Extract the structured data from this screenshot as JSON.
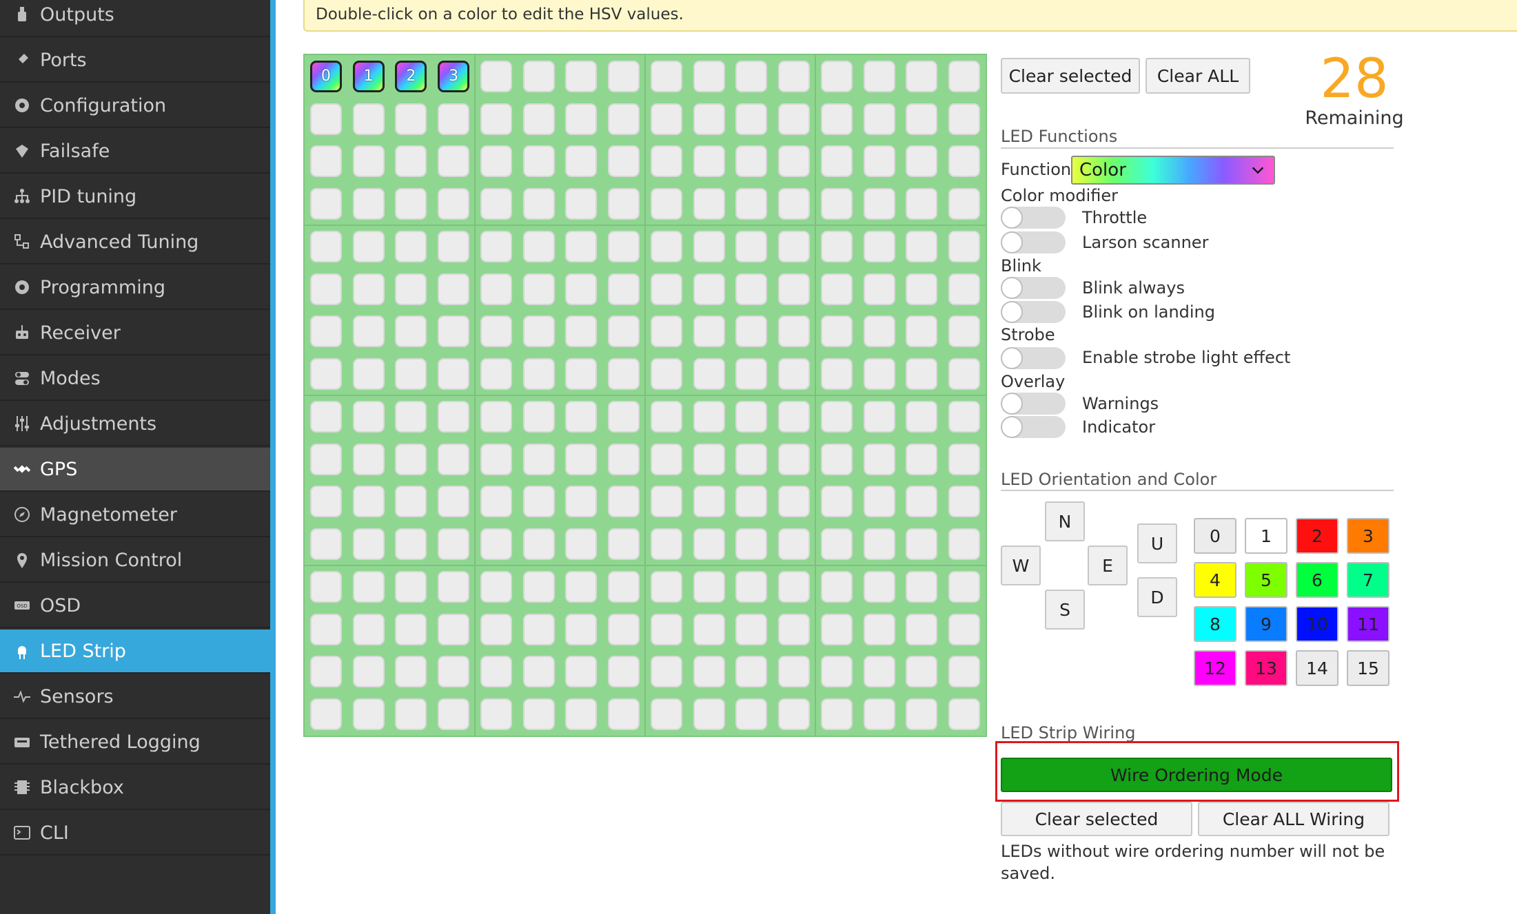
{
  "sidebar": {
    "items": [
      {
        "label": "Outputs",
        "icon": "outputs-icon"
      },
      {
        "label": "Ports",
        "icon": "ports-icon"
      },
      {
        "label": "Configuration",
        "icon": "gear-icon"
      },
      {
        "label": "Failsafe",
        "icon": "failsafe-icon"
      },
      {
        "label": "PID tuning",
        "icon": "pid-icon"
      },
      {
        "label": "Advanced Tuning",
        "icon": "advanced-tuning-icon"
      },
      {
        "label": "Programming",
        "icon": "gear-icon"
      },
      {
        "label": "Receiver",
        "icon": "receiver-icon"
      },
      {
        "label": "Modes",
        "icon": "modes-icon"
      },
      {
        "label": "Adjustments",
        "icon": "adjustments-icon"
      },
      {
        "label": "GPS",
        "icon": "satellite-icon"
      },
      {
        "label": "Magnetometer",
        "icon": "compass-icon"
      },
      {
        "label": "Mission Control",
        "icon": "map-pin-icon"
      },
      {
        "label": "OSD",
        "icon": "osd-icon"
      },
      {
        "label": "LED Strip",
        "icon": "led-icon"
      },
      {
        "label": "Sensors",
        "icon": "pulse-icon"
      },
      {
        "label": "Tethered Logging",
        "icon": "tethered-logging-icon"
      },
      {
        "label": "Blackbox",
        "icon": "blackbox-icon"
      },
      {
        "label": "CLI",
        "icon": "terminal-icon"
      }
    ],
    "active": "LED Strip",
    "accent_color": "#37a8db"
  },
  "note": {
    "text": "Double-click on a color to edit the HSV values."
  },
  "grid": {
    "rows": 16,
    "cols": 16,
    "selected": [
      {
        "label": "0"
      },
      {
        "label": "1"
      },
      {
        "label": "2"
      },
      {
        "label": "3"
      }
    ],
    "background_color": "#8fd790"
  },
  "toolbar": {
    "clear_selected": "Clear selected",
    "clear_all": "Clear ALL"
  },
  "remaining": {
    "count": "28",
    "label": "Remaining",
    "color": "#f9a825"
  },
  "led_functions": {
    "title": "LED Functions",
    "function_label": "Function",
    "function_value": "Color",
    "color_modifier_label": "Color modifier",
    "throttle": "Throttle",
    "larson": "Larson scanner",
    "blink_label": "Blink",
    "blink_always": "Blink always",
    "blink_landing": "Blink on landing",
    "strobe_label": "Strobe",
    "strobe_enable": "Enable strobe light effect",
    "overlay_label": "Overlay",
    "warnings": "Warnings",
    "indicator": "Indicator"
  },
  "orientation": {
    "title": "LED Orientation and Color",
    "n": "N",
    "w": "W",
    "e": "E",
    "s": "S",
    "u": "U",
    "d": "D"
  },
  "colors": [
    {
      "label": "0",
      "bg": "#ececec",
      "fg": "#222222"
    },
    {
      "label": "1",
      "bg": "#ffffff",
      "fg": "#222222"
    },
    {
      "label": "2",
      "bg": "#ff1010",
      "fg": "#222222"
    },
    {
      "label": "3",
      "bg": "#ff7a00",
      "fg": "#222222"
    },
    {
      "label": "4",
      "bg": "#ffff00",
      "fg": "#222222"
    },
    {
      "label": "5",
      "bg": "#7dff00",
      "fg": "#222222"
    },
    {
      "label": "6",
      "bg": "#00ff3c",
      "fg": "#222222"
    },
    {
      "label": "7",
      "bg": "#00ff8a",
      "fg": "#222222"
    },
    {
      "label": "8",
      "bg": "#00ffff",
      "fg": "#222222"
    },
    {
      "label": "9",
      "bg": "#0a7cff",
      "fg": "#222222"
    },
    {
      "label": "10",
      "bg": "#0010ff",
      "fg": "#222222"
    },
    {
      "label": "11",
      "bg": "#8a10ff",
      "fg": "#222222"
    },
    {
      "label": "12",
      "bg": "#ff00ff",
      "fg": "#222222"
    },
    {
      "label": "13",
      "bg": "#ff0a80",
      "fg": "#222222"
    },
    {
      "label": "14",
      "bg": "#ececec",
      "fg": "#222222"
    },
    {
      "label": "15",
      "bg": "#ececec",
      "fg": "#222222"
    }
  ],
  "wiring": {
    "title": "LED Strip Wiring",
    "wire_ordering": "Wire Ordering Mode",
    "clear_selected": "Clear selected",
    "clear_all_wiring": "Clear ALL Wiring",
    "note": "LEDs without wire ordering number will not be saved.",
    "button_color": "#13a116",
    "highlight_color": "#e0171c"
  }
}
